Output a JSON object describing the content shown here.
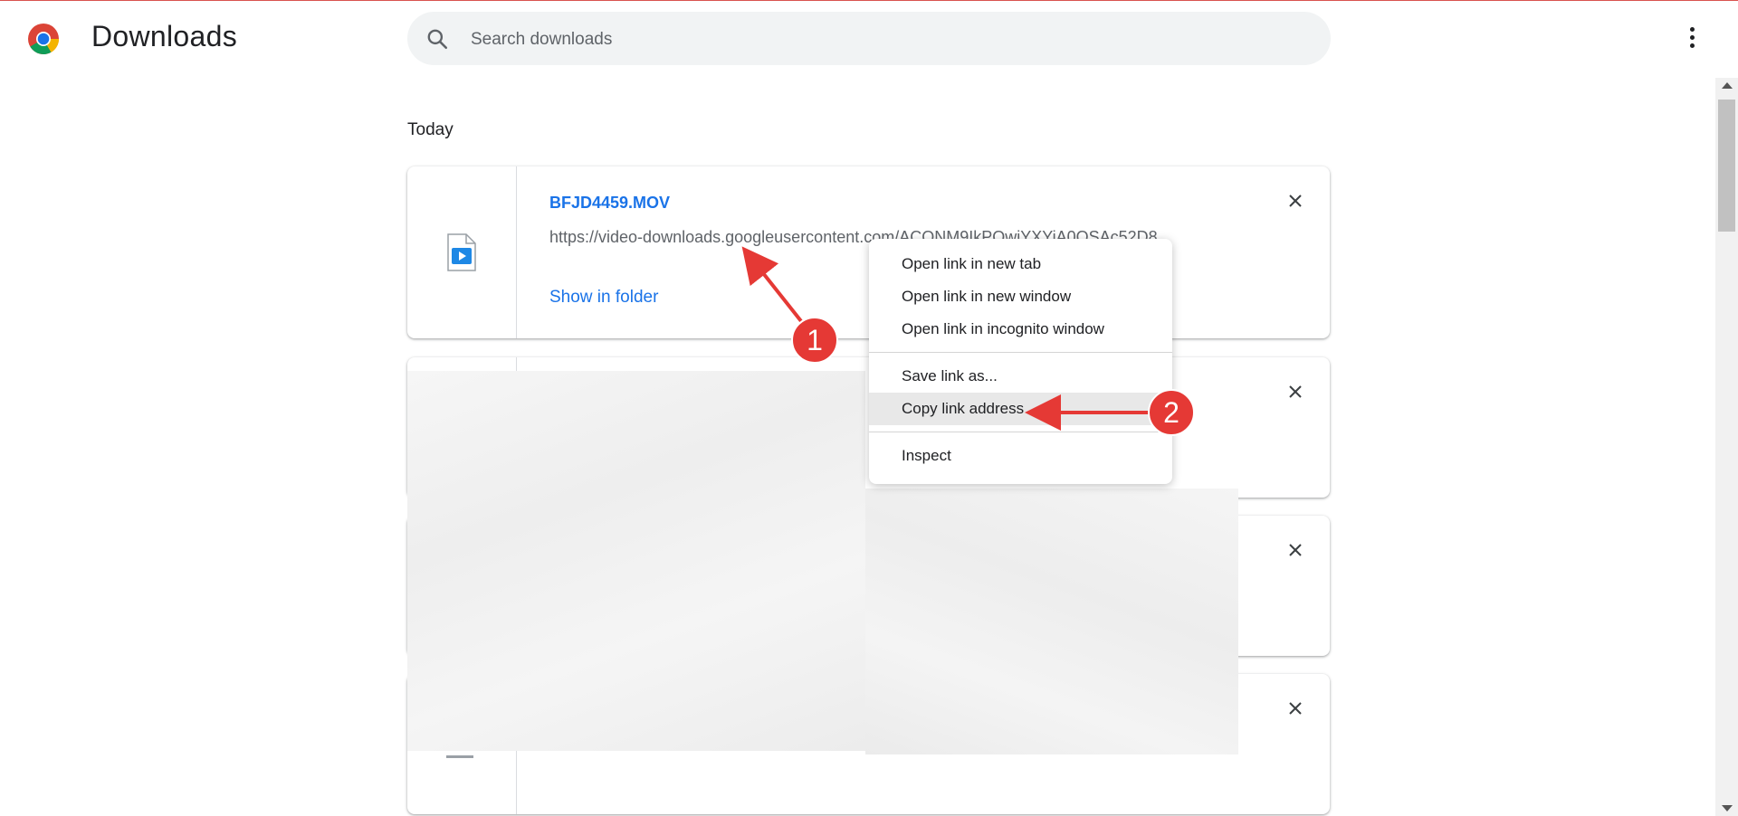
{
  "app": {
    "title": "Downloads",
    "logo_icon": "chrome-logo-icon"
  },
  "search": {
    "placeholder": "Search downloads",
    "icon": "search-icon"
  },
  "header": {
    "menu_icon": "more-vert-icon"
  },
  "section": {
    "label": "Today"
  },
  "downloads": [
    {
      "file_name": "BFJD4459.MOV",
      "url": "https://video-downloads.googleusercontent.com/ACONM9IkPOwiYXYiA0QSAc52D8...",
      "action": "Show in folder",
      "file_icon": "video-file-icon"
    }
  ],
  "blurred_cards": 3,
  "context_menu": {
    "items": [
      "Open link in new tab",
      "Open link in new window",
      "Open link in incognito window",
      "Save link as...",
      "Copy link address",
      "Inspect"
    ],
    "highlighted": "Copy link address"
  },
  "annotations": {
    "marker_1": "1",
    "marker_2": "2",
    "color": "#e53935"
  },
  "colors": {
    "link": "#1a73e8",
    "search_bg": "#f1f3f4",
    "annotation": "#e53935"
  }
}
